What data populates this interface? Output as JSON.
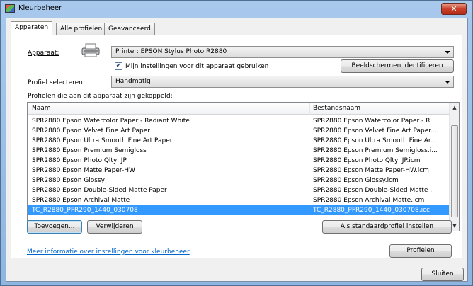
{
  "window": {
    "title": "Kleurbeheer",
    "close_label": "✕"
  },
  "tabs": [
    {
      "label": "Apparaten",
      "active": true
    },
    {
      "label": "Alle profielen",
      "active": false
    },
    {
      "label": "Geavanceerd",
      "active": false
    }
  ],
  "device": {
    "label": "Apparaat:",
    "selected": "Printer: EPSON Stylus Photo R2880",
    "checkbox_label": "Mijn instellingen voor dit apparaat gebruiken",
    "checkbox_checked": true,
    "identify_button": "Beeldschermen identificeren"
  },
  "profile_select": {
    "label": "Profiel selecteren:",
    "selected": "Handmatig"
  },
  "profiles": {
    "section_label": "Profielen die aan dit apparaat zijn gekoppeld:",
    "columns": [
      "Naam",
      "Bestandsnaam"
    ],
    "rows": [
      {
        "name": "SPR2880 Epson Watercolor Paper - Radiant White",
        "file": "SPR2880 Epson Watercolor Paper - R..."
      },
      {
        "name": "SPR2880 Epson Velvet Fine Art Paper",
        "file": "SPR2880 Epson Velvet Fine Art Paper...."
      },
      {
        "name": "SPR2880 Epson Ultra Smooth Fine Art Paper",
        "file": "SPR2880 Epson Ultra Smooth Fine Ar..."
      },
      {
        "name": "SPR2880 Epson Premium Semigloss",
        "file": "SPR2880 Epson Premium Semigloss.i..."
      },
      {
        "name": "SPR2880 Epson Photo Qlty IJP",
        "file": "SPR2880 Epson Photo Qlty IJP.icm"
      },
      {
        "name": "SPR2880 Epson Matte Paper-HW",
        "file": "SPR2880 Epson Matte Paper-HW.icm"
      },
      {
        "name": "SPR2880 Epson Glossy",
        "file": "SPR2880 Epson Glossy.icm"
      },
      {
        "name": "SPR2880 Epson Double-Sided Matte Paper",
        "file": "SPR2880 Epson Double-Sided Matte ..."
      },
      {
        "name": "SPR2880 Epson Archival Matte",
        "file": "SPR2880 Epson Archival Matte.icm"
      },
      {
        "name": "TC_R2880_PFR290_1440_030708",
        "file": "TC_R2880_PFR290_1440_030708.icc"
      }
    ],
    "selected_index": 9
  },
  "buttons": {
    "add": "Toevoegen...",
    "remove": "Verwijderen",
    "set_default": "Als standaardprofiel instellen",
    "profiles": "Profielen",
    "close": "Sluiten"
  },
  "info_link": "Meer informatie over instellingen voor kleurbeheer",
  "colors": {
    "selection": "#3399ff",
    "link": "#0066cc",
    "titlebar": "#a8c9ec"
  },
  "icons": [
    "color-management-icon",
    "printer-icon",
    "close-icon",
    "dropdown-arrow-icon",
    "checkmark-icon"
  ]
}
